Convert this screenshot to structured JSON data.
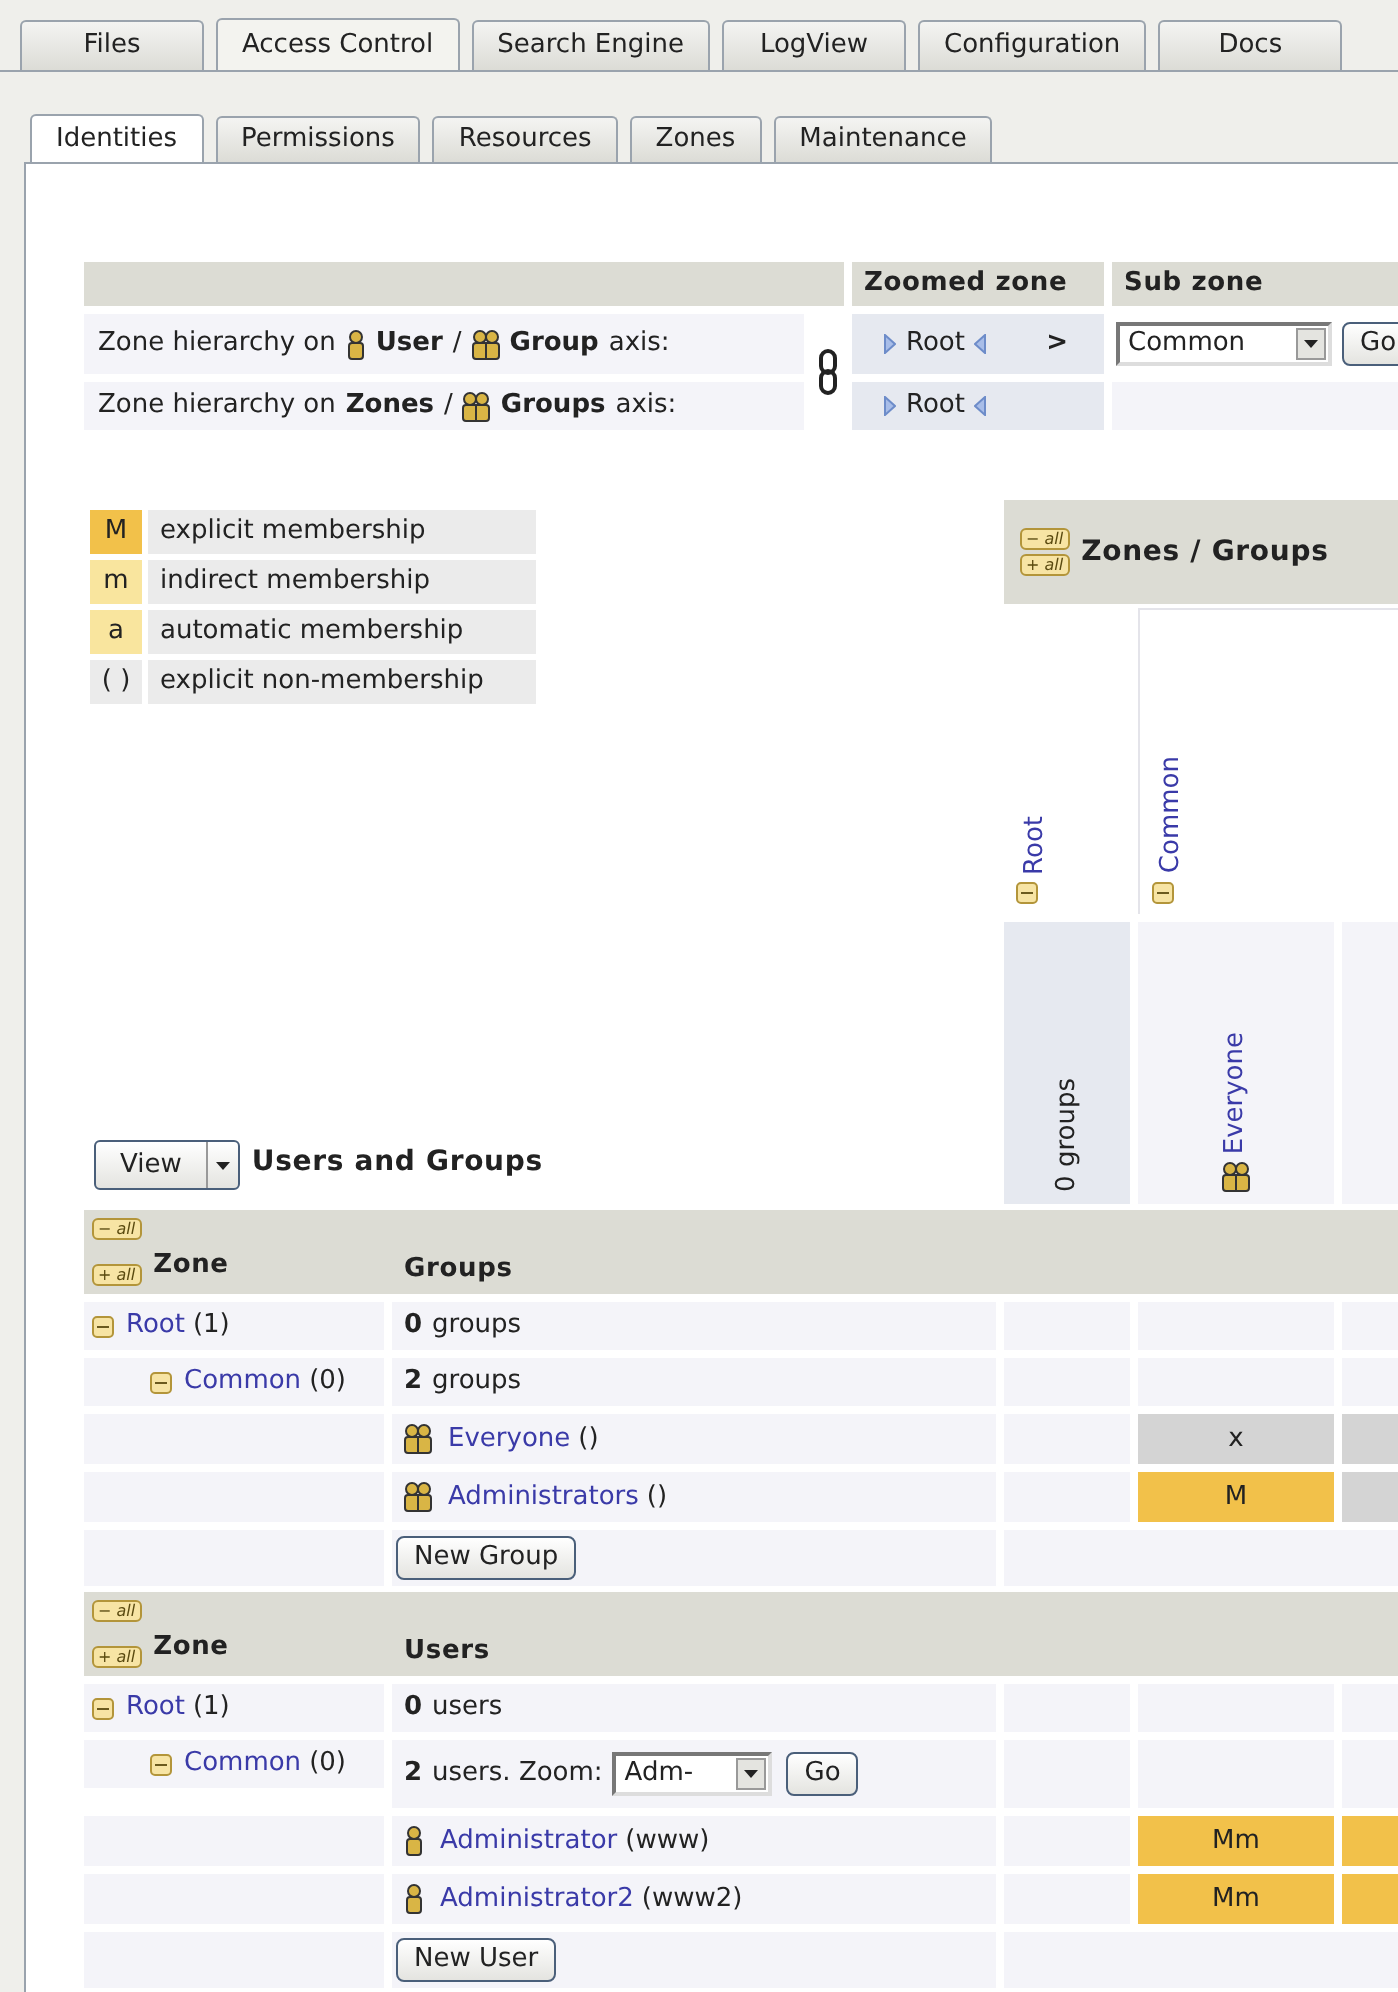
{
  "main_tabs": [
    {
      "label": "Files",
      "selected": false
    },
    {
      "label": "Access Control",
      "selected": true
    },
    {
      "label": "Search Engine",
      "selected": false
    },
    {
      "label": "LogView",
      "selected": false
    },
    {
      "label": "Configuration",
      "selected": false
    },
    {
      "label": "Docs",
      "selected": false
    }
  ],
  "sub_tabs": [
    {
      "label": "Identities",
      "selected": true
    },
    {
      "label": "Permissions",
      "selected": false
    },
    {
      "label": "Resources",
      "selected": false
    },
    {
      "label": "Zones",
      "selected": false
    },
    {
      "label": "Maintenance",
      "selected": false
    }
  ],
  "zone_hierarchy": {
    "headers": [
      "Zoomed zone",
      "Sub zone"
    ],
    "rows": [
      {
        "kind": "user_group",
        "prefix": "Zone hierarchy on",
        "first": "User",
        "separator": "/",
        "second": "Group",
        "suffix": "axis:",
        "zoomed": "Root",
        "arrow": ">",
        "sub_zone": "Common",
        "button": "Go"
      },
      {
        "kind": "zone_group",
        "prefix": "Zone hierarchy on",
        "first": "Zones",
        "separator": "/",
        "second": "Groups",
        "suffix": "axis:",
        "zoomed": "Root"
      }
    ]
  },
  "legend": [
    {
      "symbol": "M",
      "text": "explicit membership",
      "color": "#f2c14a"
    },
    {
      "symbol": "m",
      "text": "indirect membership",
      "color": "#f9e59e"
    },
    {
      "symbol": "a",
      "text": "automatic membership",
      "color": "#f9e59e"
    },
    {
      "symbol": "( )",
      "text": "explicit non-membership",
      "color": "#ebebeb"
    }
  ],
  "matrix": {
    "toggles": [
      "− all",
      "+ all"
    ],
    "title": "Zones / Groups",
    "zone_columns": [
      {
        "label": "Root",
        "expanded": true
      },
      {
        "label": "Common",
        "expanded": true
      }
    ],
    "group_columns": [
      {
        "kind": "count",
        "label": "0 groups"
      },
      {
        "kind": "group",
        "label": "Everyone"
      }
    ]
  },
  "view_button": "View",
  "section_title": "Users and Groups",
  "groups_section": {
    "toggles": [
      "− all",
      "+ all"
    ],
    "columns": [
      "Zone",
      "Groups"
    ],
    "new_button": "New Group",
    "zones": [
      {
        "name": "Root",
        "count": "(1)",
        "expanded": true,
        "summary_number": "0",
        "summary_text": "groups",
        "cells": [
          {
            "kind": "blank"
          },
          {
            "kind": "blank"
          },
          {
            "kind": "blank"
          }
        ],
        "children": [
          {
            "name": "Common",
            "count": "(0)",
            "expanded": true,
            "summary_number": "2",
            "summary_text": "groups",
            "cells": [
              {
                "kind": "blank"
              },
              {
                "kind": "blank"
              },
              {
                "kind": "blank"
              }
            ],
            "items": [
              {
                "kind": "group",
                "name": "Everyone",
                "detail": "()",
                "cells": [
                  {
                    "kind": "blank"
                  },
                  {
                    "kind": "excluded",
                    "value": "x"
                  },
                  {
                    "kind": "excluded"
                  }
                ]
              },
              {
                "kind": "group",
                "name": "Administrators",
                "detail": "()",
                "cells": [
                  {
                    "kind": "blank"
                  },
                  {
                    "kind": "explicit",
                    "value": "M"
                  },
                  {
                    "kind": "excluded"
                  }
                ]
              }
            ]
          }
        ]
      }
    ]
  },
  "users_section": {
    "toggles": [
      "− all",
      "+ all"
    ],
    "columns": [
      "Zone",
      "Users"
    ],
    "new_button": "New User",
    "zones": [
      {
        "name": "Root",
        "count": "(1)",
        "expanded": true,
        "summary_number": "0",
        "summary_text": "users",
        "cells": [
          {
            "kind": "blank"
          },
          {
            "kind": "blank"
          },
          {
            "kind": "blank"
          }
        ],
        "children": [
          {
            "name": "Common",
            "count": "(0)",
            "expanded": true,
            "summary_number": "2",
            "summary_text": "users. Zoom:",
            "zoom": {
              "value": "Adm-",
              "button": "Go"
            },
            "cells": [
              {
                "kind": "blank"
              },
              {
                "kind": "blank"
              },
              {
                "kind": "blank"
              }
            ],
            "items": [
              {
                "kind": "user",
                "name": "Administrator",
                "detail": "(www)",
                "cells": [
                  {
                    "kind": "blank"
                  },
                  {
                    "kind": "explicit",
                    "value": "Mm"
                  },
                  {
                    "kind": "explicit"
                  }
                ]
              },
              {
                "kind": "user",
                "name": "Administrator2",
                "detail": "(www2)",
                "cells": [
                  {
                    "kind": "blank"
                  },
                  {
                    "kind": "explicit",
                    "value": "Mm"
                  },
                  {
                    "kind": "explicit"
                  }
                ]
              }
            ]
          }
        ]
      }
    ]
  }
}
